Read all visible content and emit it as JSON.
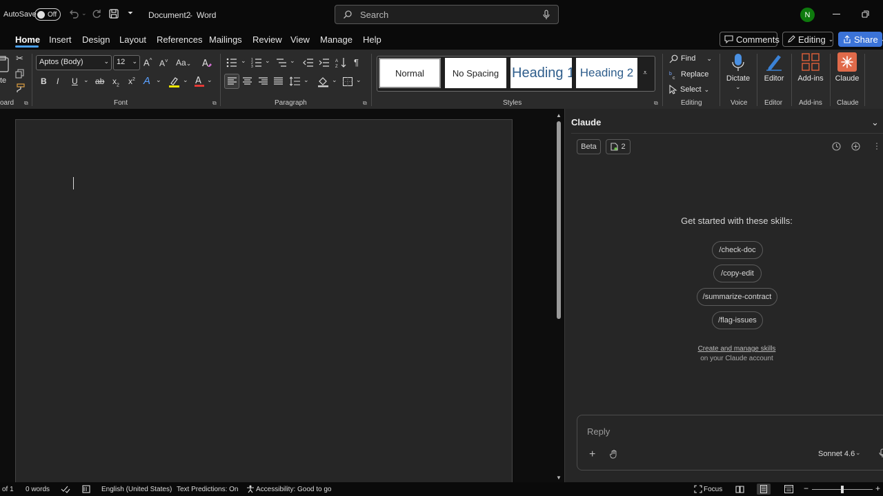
{
  "titlebar": {
    "autosave_label": "AutoSave",
    "autosave_state": "Off",
    "doc_title": "Document2",
    "separator": "-",
    "app_name": "Word",
    "search_placeholder": "Search",
    "user_initial": "N"
  },
  "menu": {
    "tabs": [
      "Home",
      "Insert",
      "Design",
      "Layout",
      "References",
      "Mailings",
      "Review",
      "View",
      "Manage",
      "Help"
    ],
    "comments_label": "Comments",
    "editing_label": "Editing",
    "share_label": "Share"
  },
  "ribbon": {
    "clipboard_label": "oard",
    "paste_label": "te",
    "font_group": "Font",
    "font_name": "Aptos (Body)",
    "font_size": "12",
    "paragraph_group": "Paragraph",
    "styles_group": "Styles",
    "styles": [
      "Normal",
      "No Spacing",
      "Heading 1",
      "Heading 2"
    ],
    "editing_group": "Editing",
    "find_label": "Find",
    "replace_label": "Replace",
    "select_label": "Select",
    "voice_group": "Voice",
    "dictate_label": "Dictate",
    "editor_group": "Editor",
    "editor_label": "Editor",
    "addins_group": "Add-ins",
    "addins_label": "Add-ins",
    "claude_group": "Claude",
    "claude_label": "Claude",
    "colors": {
      "highlight": "#f5e800",
      "font_color": "#e53935",
      "claude_icon": "#e06a4a"
    }
  },
  "pane": {
    "title": "Claude",
    "beta_label": "Beta",
    "doc_count": "2",
    "heading": "Get started with these skills:",
    "skills": [
      "/check-doc",
      "/copy-edit",
      "/summarize-contract",
      "/flag-issues"
    ],
    "manage_link": "Create and manage skills",
    "manage_sub": "on your Claude account",
    "reply_placeholder": "Reply",
    "model_label": "Sonnet 4.6"
  },
  "status": {
    "page": "of 1",
    "words": "0 words",
    "language": "English (United States)",
    "predictions": "Text Predictions: On",
    "accessibility": "Accessibility: Good to go",
    "focus": "Focus"
  }
}
